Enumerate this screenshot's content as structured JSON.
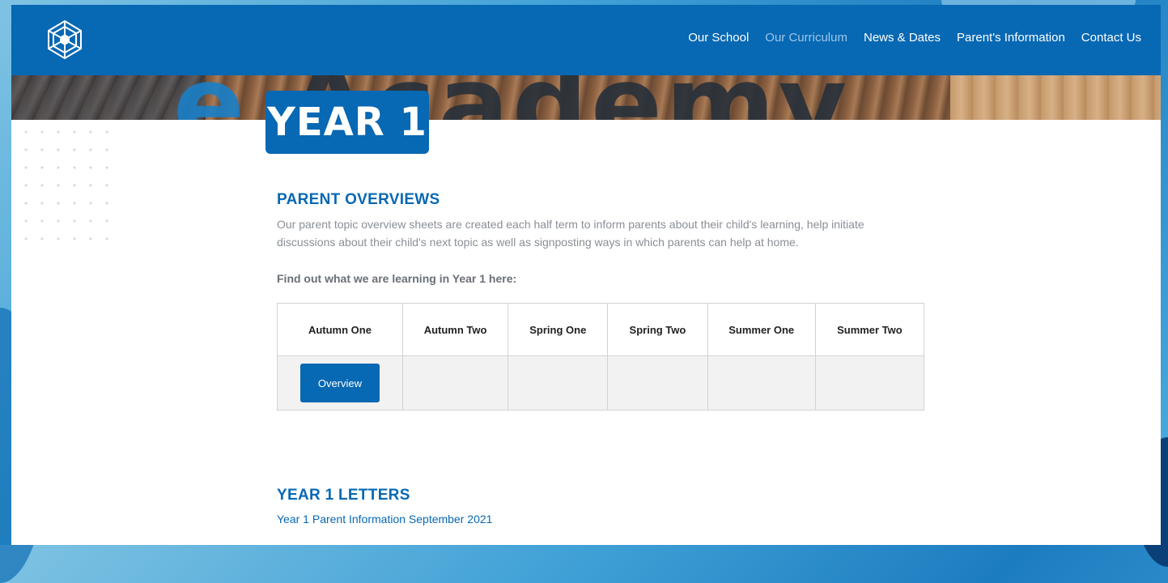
{
  "header": {
    "logo_icon": "school-crest-icon",
    "nav": [
      {
        "label": "Our School",
        "active": false
      },
      {
        "label": "Our Curriculum",
        "active": true
      },
      {
        "label": "News & Dates",
        "active": false
      },
      {
        "label": "Parent's Information",
        "active": false
      },
      {
        "label": "Contact Us",
        "active": false
      }
    ]
  },
  "banner": {
    "word": "Academy",
    "word_prefix": "e"
  },
  "page_title": "YEAR 1",
  "overviews": {
    "heading": "PARENT OVERVIEWS",
    "intro": "Our parent topic overview sheets are created each half term to inform parents about their child's learning, help initiate discussions about their child's next topic as well as signposting ways in which parents can help at home.",
    "find_text": "Find out what we are learning in Year 1 here:",
    "columns": [
      "Autumn One",
      "Autumn Two",
      "Spring One",
      "Spring Two",
      "Summer One",
      "Summer Two"
    ],
    "overview_button": "Overview"
  },
  "letters": {
    "heading": "YEAR 1 LETTERS",
    "items": [
      "Year 1 Parent Information September 2021"
    ]
  },
  "colors": {
    "primary": "#0768b3",
    "nav_active": "#9cc7ea",
    "text_muted": "#8a8f96"
  }
}
